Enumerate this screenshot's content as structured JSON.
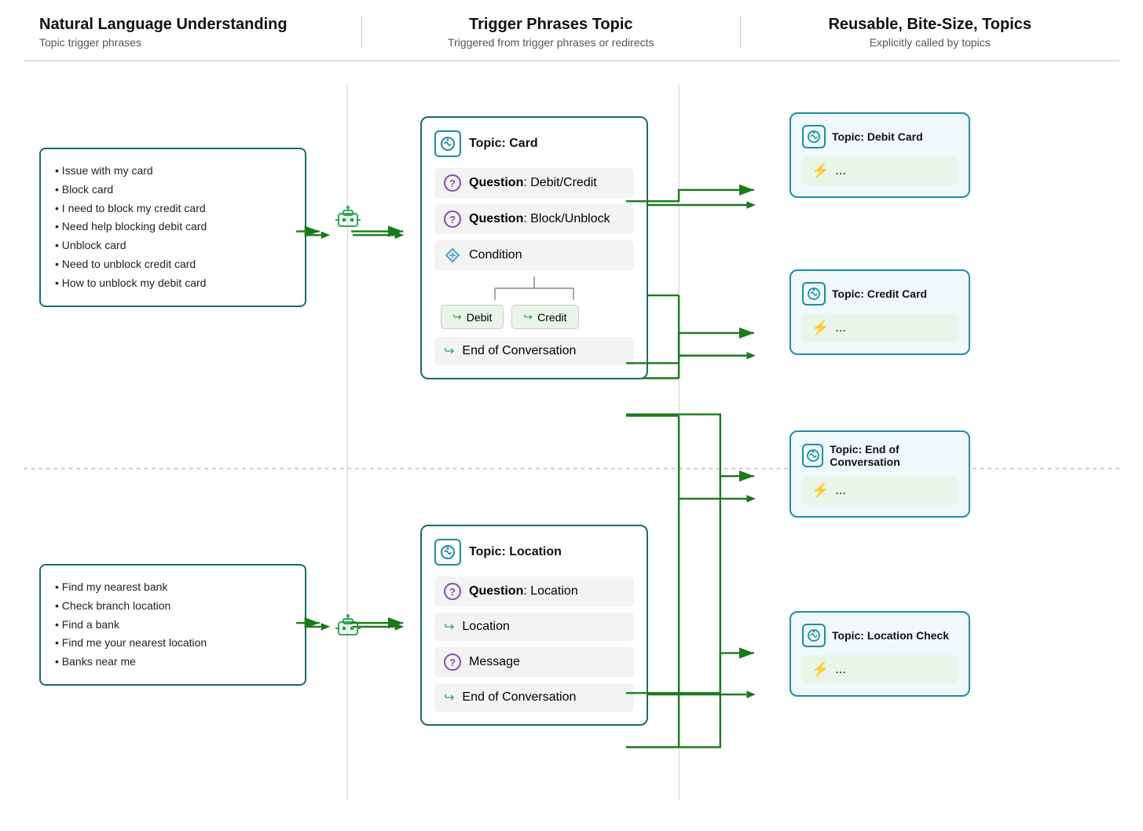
{
  "header": {
    "col1": {
      "title": "Natural Language Understanding",
      "subtitle": "Topic trigger phrases"
    },
    "col2": {
      "title": "Trigger Phrases Topic",
      "subtitle": "Triggered from trigger phrases or redirects"
    },
    "col3": {
      "title": "Reusable, Bite-Size, Topics",
      "subtitle": "Explicitly called by topics"
    }
  },
  "nlu_top": {
    "phrases": [
      "• Issue with my card",
      "• Block card",
      "• I need to block my credit card",
      "• Need help blocking debit card",
      "• Unblock card",
      "• Need to unblock credit card",
      "• How to unblock my debit card"
    ]
  },
  "nlu_bottom": {
    "phrases": [
      "• Find my nearest bank",
      "• Check branch location",
      "• Find a bank",
      "• Find me your nearest location",
      "• Banks near me"
    ]
  },
  "topic_card": {
    "title": "Topic: Card",
    "steps": [
      {
        "type": "question",
        "label": "Question",
        "value": "Debit/Credit"
      },
      {
        "type": "question",
        "label": "Question",
        "value": "Block/Unblock"
      },
      {
        "type": "condition",
        "label": "Condition",
        "value": ""
      }
    ],
    "branches": [
      {
        "label": "Debit"
      },
      {
        "label": "Credit"
      }
    ],
    "eoc": "End of Conversation"
  },
  "topic_location": {
    "title": "Topic: Location",
    "steps": [
      {
        "type": "question",
        "label": "Question",
        "value": "Location"
      },
      {
        "type": "redirect",
        "label": "Location",
        "value": ""
      },
      {
        "type": "question",
        "label": "Message",
        "value": ""
      },
      {
        "type": "redirect",
        "label": "End of Conversation",
        "value": ""
      }
    ]
  },
  "reusable": {
    "debit": {
      "title": "Topic: Debit Card",
      "content": "..."
    },
    "credit": {
      "title": "Topic: Credit Card",
      "content": "..."
    },
    "eoc": {
      "title": "Topic: End of Conversation",
      "content": "..."
    },
    "loccheck": {
      "title": "Topic: Location Check",
      "content": "..."
    }
  }
}
